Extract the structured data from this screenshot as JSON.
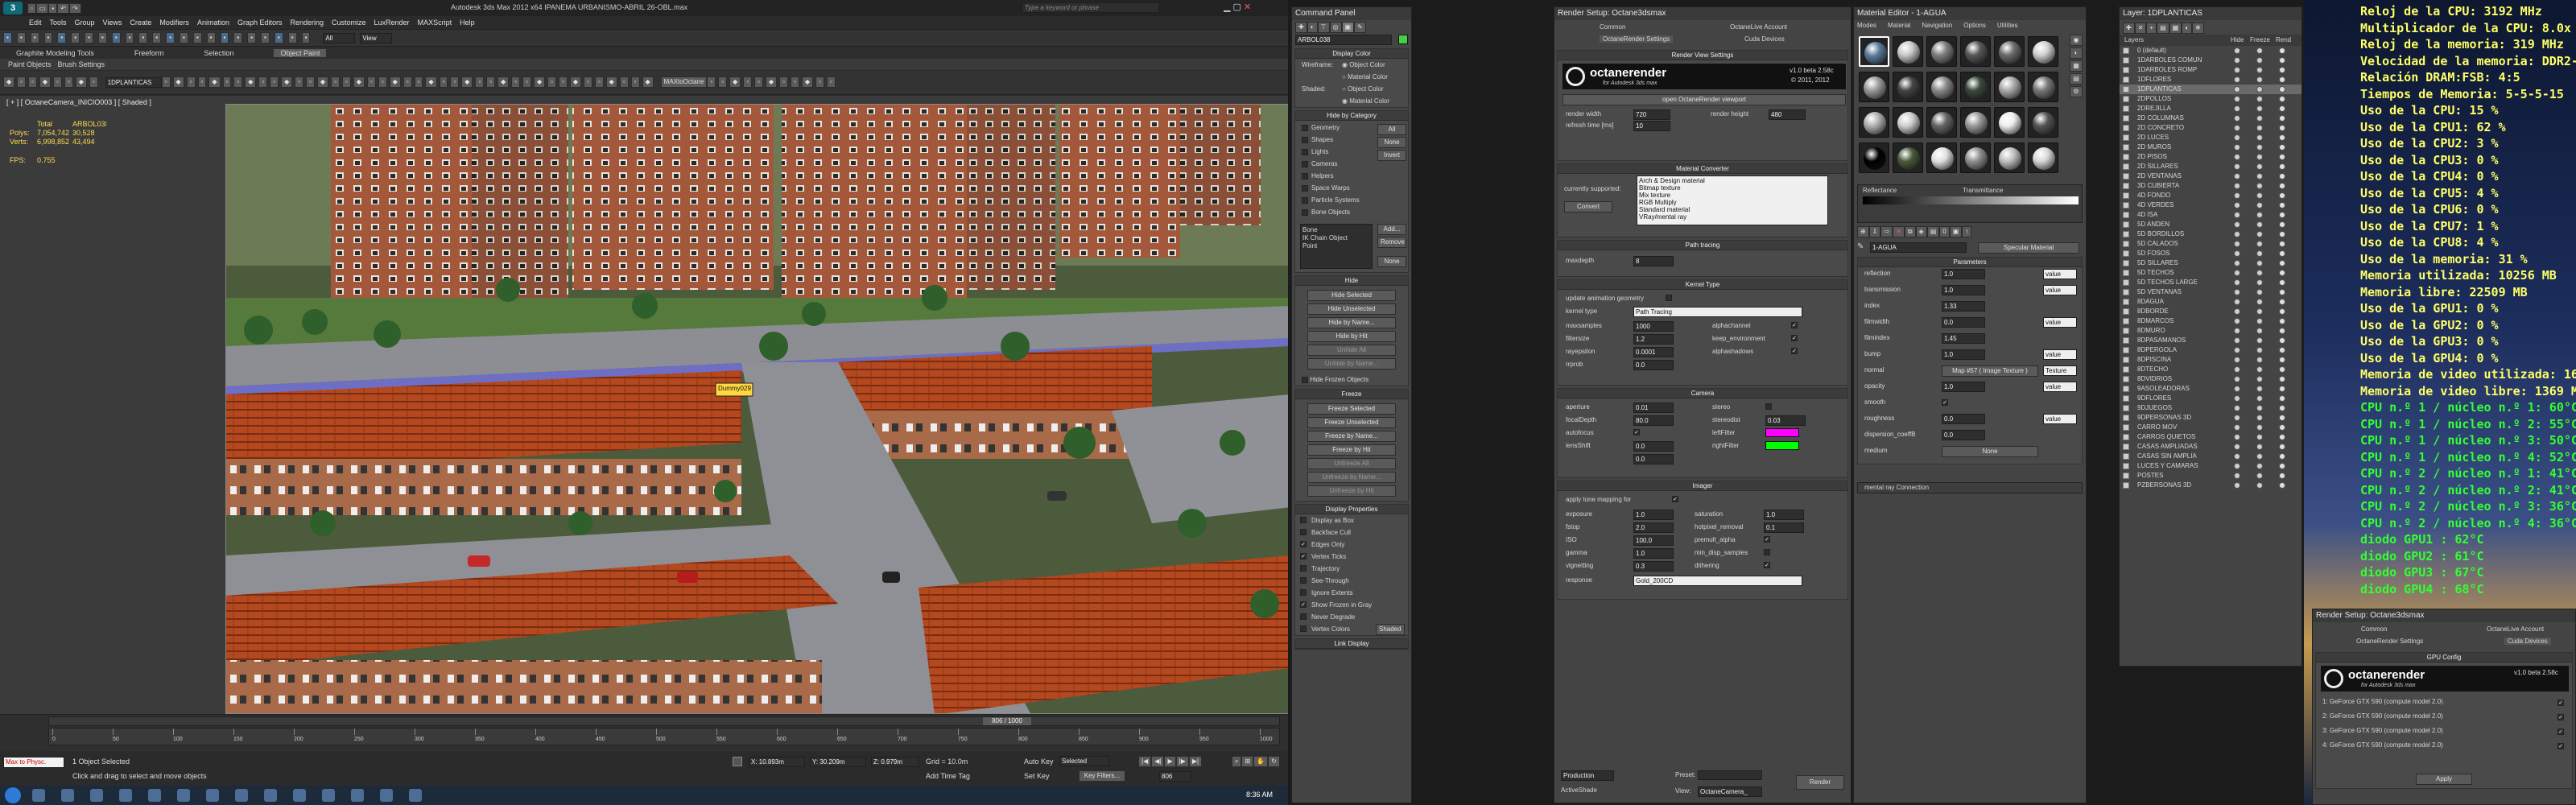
{
  "app_title": "Autodesk 3ds Max 2012 x64   IPANEMA URBANISMO-ABRIL 26-OBL.max",
  "search_placeholder": "Type a keyword or phrase",
  "menu": [
    "Edit",
    "Tools",
    "Group",
    "Views",
    "Create",
    "Modifiers",
    "Animation",
    "Graph Editors",
    "Rendering",
    "Customize",
    "LuxRender",
    "MAXScript",
    "Help"
  ],
  "ribbon_tabs": [
    "Graphite Modeling Tools",
    "Freeform",
    "Selection",
    "Object Paint"
  ],
  "ribbon_sub": [
    "Paint Objects",
    "Brush Settings"
  ],
  "toolbar": {
    "selection_set": "All",
    "view": "View",
    "layer": "1DPLANTICAS",
    "octane_btn": "MAXtoOctane"
  },
  "viewport": {
    "label": "[ + ] [ OctaneCamera_INICIO003 ] [ Shaded ]",
    "stats_total": "Total",
    "stats_object": "ARBOL038",
    "polys_label": "Polys:",
    "polys_total": "7,054,742",
    "polys_obj": "30,528",
    "verts_label": "Verts:",
    "verts_total": "6,998,852",
    "verts_obj": "43,494",
    "fps_label": "FPS:",
    "fps_value": "0.755",
    "dummy_label": "Dummy029"
  },
  "timeline": {
    "frame": "806 / 1000",
    "ticks": [
      "0",
      "50",
      "100",
      "150",
      "200",
      "250",
      "300",
      "350",
      "400",
      "450",
      "500",
      "550",
      "600",
      "650",
      "700",
      "750",
      "800",
      "850",
      "900",
      "950",
      "1000"
    ]
  },
  "status": {
    "script": "Max to Physc.",
    "selected": "1 Object Selected",
    "prompt": "Click and drag to select and move objects",
    "x": "X: 10.893m",
    "y": "Y: 30.209m",
    "z": "Z: 0.979m",
    "grid": "Grid = 10.0m",
    "addtime": "Add Time Tag",
    "autokey": "Auto Key",
    "setkey": "Set Key",
    "selected_dd": "Selected",
    "keyfilters": "Key Filters...",
    "frame_field": "806"
  },
  "taskbar": {
    "clock": "8:36 AM"
  },
  "command_panel": {
    "title": "Command Panel",
    "object_name": "ARBOL038",
    "display_color": {
      "header": "Display Color",
      "wireframe": "Wireframe:",
      "shaded": "Shaded:",
      "object_color": "Object Color",
      "material_color": "Material Color"
    },
    "hide_by_category": {
      "header": "Hide by Category",
      "items": [
        "Geometry",
        "Shapes",
        "Lights",
        "Cameras",
        "Helpers",
        "Space Warps",
        "Particle Systems",
        "Bone Objects"
      ],
      "buttons": [
        "All",
        "None",
        "Invert"
      ],
      "list": [
        "Bone",
        "IK Chain Object",
        "Point"
      ],
      "add": "Add...",
      "remove": "Remove",
      "none": "None"
    },
    "hide": {
      "header": "Hide",
      "buttons": [
        "Hide Selected",
        "Hide Unselected",
        "Hide by Name...",
        "Hide by Hit",
        "Unhide All",
        "Unhide by Name..."
      ],
      "frozen": "Hide Frozen Objects"
    },
    "freeze": {
      "header": "Freeze",
      "buttons": [
        "Freeze Selected",
        "Freeze Unselected",
        "Freeze by Name...",
        "Freeze by Hit",
        "Unfreeze All",
        "Unfreeze by Name...",
        "Unfreeze by Hit"
      ]
    },
    "display_props": {
      "header": "Display Properties",
      "items": [
        "Display as Box",
        "Backface Cull",
        "Edges Only",
        "Vertex Ticks",
        "Trajectory",
        "See-Through",
        "Ignore Extents",
        "Show Frozen in Gray",
        "Never Degrade",
        "Vertex Colors"
      ],
      "checked": [
        false,
        false,
        true,
        true,
        false,
        false,
        false,
        true,
        false,
        false
      ],
      "shaded": "Shaded"
    },
    "link_display": "Link Display"
  },
  "render_setup": {
    "title": "Render Setup: Octane3dsmax",
    "tabs": [
      "Common",
      "OctaneLive Account",
      "OctaneRender Settings",
      "Cuda Devices"
    ],
    "view_settings": "Render View Settings",
    "logo": "octanerender",
    "logo_sub": "for Autodesk 3ds max",
    "version": "v1.0 beta 2.58c",
    "copyright": "© 2011, 2012",
    "open_viewport": "open OctaneRender viewport",
    "render_width_label": "render width",
    "render_width": "720",
    "render_height_label": "render height",
    "render_height": "480",
    "refresh_label": "refresh time [ms]",
    "refresh": "10",
    "material_converter": "Material Converter",
    "currently_supported": "currently supported:",
    "supported": [
      "Arch & Design material",
      "Bitmap texture",
      "Mix texture",
      "RGB Multiply",
      "Standard material",
      "VRay/mental ray"
    ],
    "convert": "Convert",
    "path_tracing": "Path tracing",
    "maxdepth_label": "maxdepth",
    "maxdepth": "8",
    "kernel_type_header": "Kernel Type",
    "update_anim": "update animation geometry",
    "kernel_type_label": "kernel type",
    "kernel_type": "Path Tracing",
    "maxsamples_label": "maxsamples",
    "maxsamples": "1000",
    "filtersize_label": "filtersize",
    "filtersize": "1.2",
    "raydepth_label": "rayepsilon",
    "raydepth": "0.0001",
    "rrprob_label": "rrprob",
    "rrprob": "0.0",
    "alphachannel": "alphachannel",
    "keep_env": "keep_environment",
    "alphashadow": "alphashadows",
    "camera_header": "Camera",
    "aperture_label": "aperture",
    "aperture": "0.01",
    "focal_label": "focalDepth",
    "focal": "80.0",
    "autofocus_label": "autofocus",
    "lensshift_label": "lensShift",
    "lensx": "0.0",
    "lensy": "0.0",
    "stereo": "stereo",
    "stereodist_label": "stereodist",
    "stereodist": "0.03",
    "leftfilter": "leftFilter",
    "rightfilter": "rightFilter",
    "left_color": "#ff00ff",
    "right_color": "#00ff00",
    "imager_header": "Imager",
    "tonemap": "apply tone mapping for",
    "exposure_label": "exposure",
    "exposure": "1.0",
    "fstop_label": "fstop",
    "fstop": "2.0",
    "iso_label": "ISO",
    "iso": "100.0",
    "gamma_label": "gamma",
    "gamma": "1.0",
    "vignetting_label": "vignetting",
    "vignetting": "0.3",
    "response_label": "response",
    "response": "Gold_200CD",
    "saturation_label": "saturation",
    "saturation": "1.0",
    "hotpixel_label": "hotpixel_removal",
    "hotpixel": "0.1",
    "premult": "premult_alpha",
    "minsamples": "min_disp_samples",
    "dithering": "dithering",
    "footer": {
      "production": "Production",
      "preset": "Preset:",
      "activeshade": "ActiveShade",
      "view": "View:",
      "view_value": "OctaneCamera_",
      "render": "Render"
    }
  },
  "material_editor": {
    "title": "Material Editor - 1-AGUA",
    "menu": [
      "Modes",
      "Material",
      "Navigation",
      "Options",
      "Utilities"
    ],
    "slot_name": "1-AGUA",
    "slot_type": "Specular Material",
    "params_header": "Parameters",
    "reflectance": "Reflectance",
    "transmittance": "Transmittance",
    "params": [
      {
        "l": "reflection",
        "v": "1.0",
        "t": "value"
      },
      {
        "l": "transmission",
        "v": "1.0",
        "t": "value"
      },
      {
        "l": "index",
        "v": "1.33",
        "t": ""
      },
      {
        "l": "filmwidth",
        "v": "0.0",
        "t": "value"
      },
      {
        "l": "filmindex",
        "v": "1.45",
        "t": ""
      },
      {
        "l": "bump",
        "v": "1.0",
        "t": "value"
      },
      {
        "l": "normal",
        "v": "1.0",
        "t": "Texture"
      },
      {
        "l": "opacity",
        "v": "1.0",
        "t": "value"
      },
      {
        "l": "smooth",
        "v": "",
        "t": ""
      },
      {
        "l": "roughness",
        "v": "0.0",
        "t": "value"
      },
      {
        "l": "dispersion_coeffB",
        "v": "0.0",
        "t": ""
      },
      {
        "l": "medium",
        "v": "",
        "t": ""
      }
    ],
    "normal_map": "Map #57 ( Image Texture )",
    "medium_value": "None",
    "mr_connection": "mental ray Connection"
  },
  "layer_panel": {
    "title": "Layer: 1DPLANTICAS",
    "cols": [
      "Layers",
      "Hide",
      "Freeze",
      "Rend"
    ],
    "layers": [
      "0 (default)",
      "1DARBOLES COMUN",
      "1DARBOLES ROMP",
      "1DFLORES",
      "1DPLANTICAS",
      "2DPOLLOS",
      "2DREJILLA",
      "2D COLUMNAS",
      "2D CONCRETO",
      "2D LUCES",
      "2D MUROS",
      "2D PISOS",
      "2D SILLARES",
      "2D VENTANAS",
      "3D CUBIERTA",
      "4D FONDO",
      "4D VERDES",
      "4D ISA",
      "5D ANDEN",
      "5D BORDILLOS",
      "5D CALADOS",
      "5D FOSOS",
      "5D SILLARES",
      "5D TECHOS",
      "5D TECHOS LARGE",
      "5D VENTANAS",
      "8DAGUA",
      "8DBORDE",
      "8DMARCOS",
      "8DMURO",
      "8DPASAMANOS",
      "8DPERGOLA",
      "8DPISCINA",
      "8DTECHO",
      "8DVIDRIOS",
      "9ASOLEADORAS",
      "9DFLORES",
      "9DJUEGOS",
      "9DPERSONAS 3D",
      "CARRO MOV",
      "CARROS QUIETOS",
      "CASAS AMPLIADAS",
      "CASAS SIN AMPLIA",
      "LUCES Y CAMARAS",
      "POSTES",
      "PZBERSONAS 3D"
    ]
  },
  "render_setup2": {
    "title": "Render Setup: Octane3dsmax",
    "tabs": [
      "Common",
      "OctaneLive Account",
      "OctaneRender Settings",
      "Cuda Devices"
    ],
    "gpu_config": "GPU Config",
    "gpus": [
      "1: GeForce GTX 590 (compute model 2.0)",
      "2: GeForce GTX 590 (compute model 2.0)",
      "3: GeForce GTX 590 (compute model 2.0)",
      "4: GeForce GTX 590 (compute model 2.0)"
    ],
    "apply": "Apply"
  },
  "stats": [
    {
      "t": "Reloj de la CPU: 3192 MHz",
      "c": "#ffff66"
    },
    {
      "t": "Multiplicador de la CPU: 8.0x",
      "c": "#ffff66"
    },
    {
      "t": "Reloj de la memoria: 319 MHz",
      "c": "#ffff66"
    },
    {
      "t": "Velocidad de la memoria: DDR2-638",
      "c": "#ffff66"
    },
    {
      "t": "Relación DRAM:FSB: 4:5",
      "c": "#ffff66"
    },
    {
      "t": "Tiempos de Memoria: 5-5-5-15",
      "c": "#ffff66"
    },
    {
      "t": "Uso de la CPU: 15 %",
      "c": "#ffff66"
    },
    {
      "t": "Uso de la CPU1: 62 %",
      "c": "#ffff66"
    },
    {
      "t": "Uso de la CPU2: 3 %",
      "c": "#ffff66"
    },
    {
      "t": "Uso de la CPU3: 0 %",
      "c": "#ffff66"
    },
    {
      "t": "Uso de la CPU4: 0 %",
      "c": "#ffff66"
    },
    {
      "t": "Uso de la CPU5: 4 %",
      "c": "#ffff66"
    },
    {
      "t": "Uso de la CPU6: 0 %",
      "c": "#ffff66"
    },
    {
      "t": "Uso de la CPU7: 1 %",
      "c": "#ffff66"
    },
    {
      "t": "Uso de la CPU8: 4 %",
      "c": "#ffff66"
    },
    {
      "t": "Uso de la memoria: 31 %",
      "c": "#ffff66"
    },
    {
      "t": "Memoria utilizada: 10256 MB",
      "c": "#ffff66"
    },
    {
      "t": "Memoria libre: 22509 MB",
      "c": "#ffff66"
    },
    {
      "t": "Uso de la GPU1: 0 %",
      "c": "#ffff66"
    },
    {
      "t": "Uso de la GPU2: 0 %",
      "c": "#ffff66"
    },
    {
      "t": "Uso de la GPU3: 0 %",
      "c": "#ffff66"
    },
    {
      "t": "Uso de la GPU4: 0 %",
      "c": "#ffff66"
    },
    {
      "t": "Memoria de video utilizada: 166 MB",
      "c": "#ffff66"
    },
    {
      "t": "Memoria de video libre: 1369 MB",
      "c": "#ffff66"
    },
    {
      "t": "CPU n.º 1 / núcleo n.º 1: 60°C",
      "c": "#33ff33"
    },
    {
      "t": "CPU n.º 1 / núcleo n.º 2: 55°C",
      "c": "#33ff33"
    },
    {
      "t": "CPU n.º 1 / núcleo n.º 3: 50°C",
      "c": "#33ff33"
    },
    {
      "t": "CPU n.º 1 / núcleo n.º 4: 52°C",
      "c": "#33ff33"
    },
    {
      "t": "CPU n.º 2 / núcleo n.º 1: 41°C",
      "c": "#33ff33"
    },
    {
      "t": "CPU n.º 2 / núcleo n.º 2: 41°C",
      "c": "#33ff33"
    },
    {
      "t": "CPU n.º 2 / núcleo n.º 3: 36°C",
      "c": "#33ff33"
    },
    {
      "t": "CPU n.º 2 / núcleo n.º 4: 36°C",
      "c": "#33ff33"
    },
    {
      "t": "diodo GPU1 : 62°C",
      "c": "#33ff33"
    },
    {
      "t": "diodo GPU2 : 61°C",
      "c": "#33ff33"
    },
    {
      "t": "diodo GPU3 : 67°C",
      "c": "#33ff33"
    },
    {
      "t": "diodo GPU4 : 68°C",
      "c": "#33ff33"
    }
  ]
}
